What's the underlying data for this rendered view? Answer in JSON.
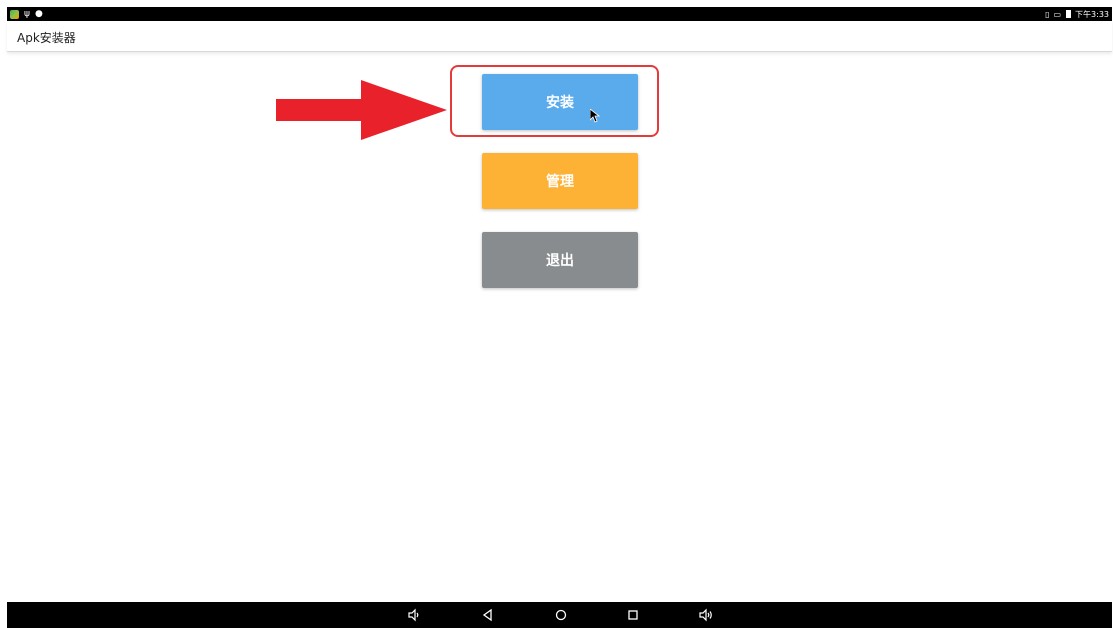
{
  "status_bar": {
    "left_icons": [
      "app-notification-icon",
      "usb-icon",
      "debug-icon"
    ],
    "right_icons": [
      "sim-icon",
      "screen-icon",
      "battery-icon"
    ],
    "time": "下午3:33"
  },
  "app_bar": {
    "title": "Apk安装器"
  },
  "buttons": {
    "install": {
      "label": "安装",
      "color": "#5aabeb"
    },
    "manage": {
      "label": "管理",
      "color": "#fdb236"
    },
    "exit": {
      "label": "退出",
      "color": "#888c8f"
    }
  },
  "annotation": {
    "highlight_color": "#e53a3a",
    "arrow_color": "#e8212a"
  },
  "nav_bar": {
    "icons": [
      "volume-down-icon",
      "back-icon",
      "home-icon",
      "recents-icon",
      "volume-up-icon"
    ]
  }
}
